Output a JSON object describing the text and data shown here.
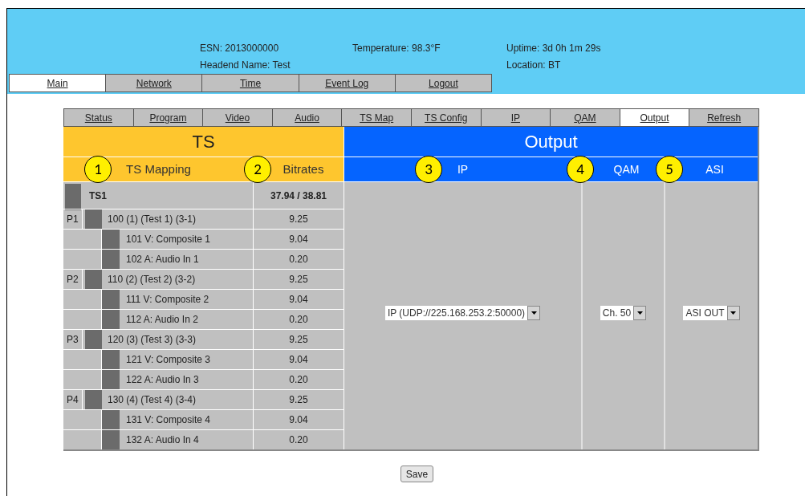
{
  "header": {
    "esn": "ESN: 2013000000",
    "headend_name": "Headend Name: Test",
    "temperature": "Temperature: 98.3°F",
    "uptime": "Uptime: 3d 0h 1m 29s",
    "location": "Location: BT"
  },
  "main_tabs": [
    {
      "label": "Main",
      "selected": true
    },
    {
      "label": "Network",
      "selected": false
    },
    {
      "label": "Time",
      "selected": false
    },
    {
      "label": "Event Log",
      "selected": false
    },
    {
      "label": "Logout",
      "selected": false
    }
  ],
  "sub_tabs": [
    {
      "label": "Status",
      "selected": false
    },
    {
      "label": "Program",
      "selected": false
    },
    {
      "label": "Video",
      "selected": false
    },
    {
      "label": "Audio",
      "selected": false
    },
    {
      "label": "TS Map",
      "selected": false
    },
    {
      "label": "TS Config",
      "selected": false
    },
    {
      "label": "IP",
      "selected": false
    },
    {
      "label": "QAM",
      "selected": false
    },
    {
      "label": "Output",
      "selected": true
    },
    {
      "label": "Refresh",
      "selected": false
    }
  ],
  "ts": {
    "title": "TS",
    "columns": [
      {
        "label": "TS Mapping",
        "callout": "1"
      },
      {
        "label": "Bitrates",
        "callout": "2"
      }
    ]
  },
  "output": {
    "title": "Output",
    "columns": [
      {
        "label": "IP",
        "callout": "3",
        "value": "IP (UDP://225.168.253.2:50000)"
      },
      {
        "label": "QAM",
        "callout": "4",
        "value": "Ch. 50"
      },
      {
        "label": "ASI",
        "callout": "5",
        "value": "ASI OUT"
      }
    ]
  },
  "rows": [
    {
      "kind": "ts",
      "name": "TS1",
      "bitrate": "37.94 / 38.81"
    },
    {
      "kind": "program",
      "tag": "P1",
      "name": "100 (1) (Test 1) (3-1)",
      "bitrate": "9.25"
    },
    {
      "kind": "stream",
      "name": "101 V: Composite 1",
      "bitrate": "9.04"
    },
    {
      "kind": "stream",
      "name": "102 A: Audio In 1",
      "bitrate": "0.20"
    },
    {
      "kind": "program",
      "tag": "P2",
      "name": "110 (2) (Test 2) (3-2)",
      "bitrate": "9.25"
    },
    {
      "kind": "stream",
      "name": "111 V: Composite 2",
      "bitrate": "9.04"
    },
    {
      "kind": "stream",
      "name": "112 A: Audio In 2",
      "bitrate": "0.20"
    },
    {
      "kind": "program",
      "tag": "P3",
      "name": "120 (3) (Test 3) (3-3)",
      "bitrate": "9.25"
    },
    {
      "kind": "stream",
      "name": "121 V: Composite 3",
      "bitrate": "9.04"
    },
    {
      "kind": "stream",
      "name": "122 A: Audio In 3",
      "bitrate": "0.20"
    },
    {
      "kind": "program",
      "tag": "P4",
      "name": "130 (4) (Test 4) (3-4)",
      "bitrate": "9.25"
    },
    {
      "kind": "stream",
      "name": "131 V: Composite 4",
      "bitrate": "9.04"
    },
    {
      "kind": "stream",
      "name": "132 A: Audio In 4",
      "bitrate": "0.20"
    }
  ],
  "save_button": "Save"
}
